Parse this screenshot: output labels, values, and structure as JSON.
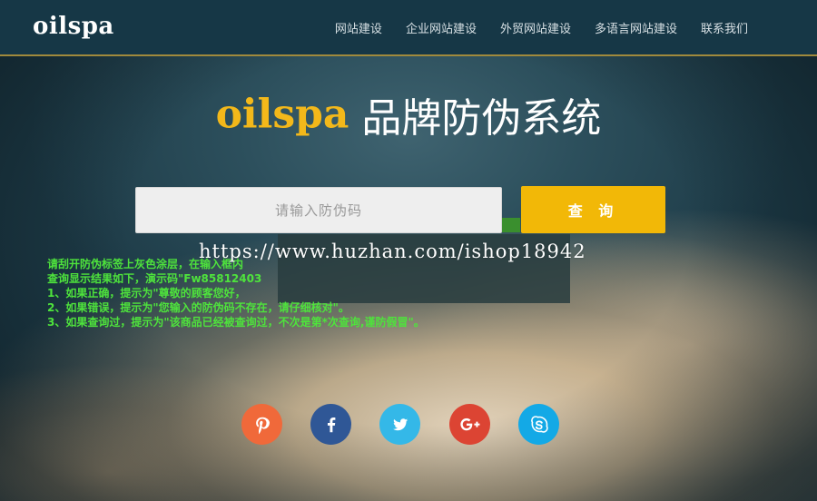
{
  "header": {
    "logo": "oilspa",
    "nav": [
      {
        "label": "网站建设"
      },
      {
        "label": "企业网站建设"
      },
      {
        "label": "外贸网站建设"
      },
      {
        "label": "多语言网站建设"
      },
      {
        "label": "联系我们"
      }
    ]
  },
  "hero": {
    "brand": "oilspa",
    "title": "品牌防伪系统"
  },
  "search": {
    "placeholder": "请输入防伪码",
    "button_label": "查 询"
  },
  "watermark": "https://www.huzhan.com/ishop18942",
  "instructions": [
    "请刮开防伪标签上灰色涂层，在输入框内",
    "查询显示结果如下，演示码\"Fw85812403",
    "1、如果正确，提示为\"尊敬的顾客您好，",
    "2、如果错误，提示为\"您输入的防伪码不存在，请仔细核对\"。",
    "3、如果查询过，提示为\"该商品已经被查询过，不次是第*次查询,谨防假冒\"。"
  ],
  "socials": [
    {
      "icon": "pinterest-icon",
      "color": "#f0693a"
    },
    {
      "icon": "facebook-icon",
      "color": "#2f5796"
    },
    {
      "icon": "twitter-icon",
      "color": "#34b8e8"
    },
    {
      "icon": "google-plus-icon",
      "color": "#dc4433"
    },
    {
      "icon": "skype-icon",
      "color": "#13a9e6"
    }
  ]
}
